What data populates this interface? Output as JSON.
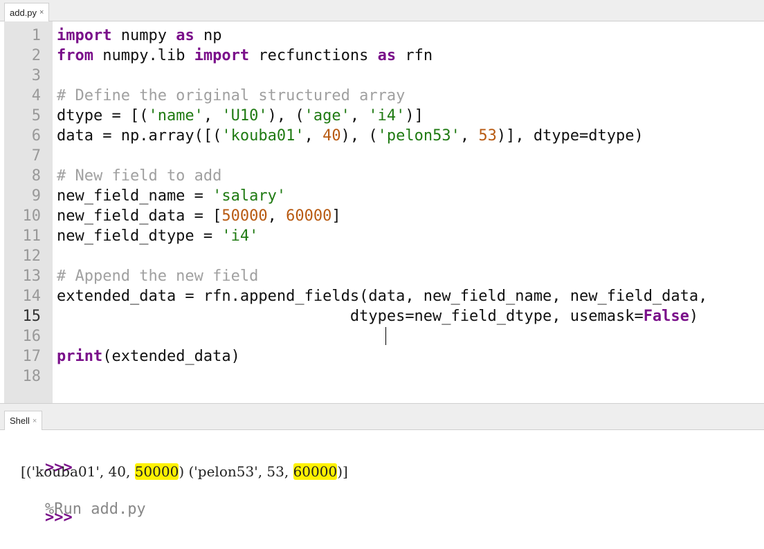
{
  "editor": {
    "tab": {
      "label": "add.py",
      "close": "×"
    },
    "lines": [
      {
        "num": "1",
        "tokens": [
          {
            "t": "kw",
            "v": "import"
          },
          {
            "t": "",
            "v": " numpy "
          },
          {
            "t": "kw",
            "v": "as"
          },
          {
            "t": "",
            "v": " np"
          }
        ]
      },
      {
        "num": "2",
        "tokens": [
          {
            "t": "kw",
            "v": "from"
          },
          {
            "t": "",
            "v": " numpy.lib "
          },
          {
            "t": "kw",
            "v": "import"
          },
          {
            "t": "",
            "v": " recfunctions "
          },
          {
            "t": "kw",
            "v": "as"
          },
          {
            "t": "",
            "v": " rfn"
          }
        ]
      },
      {
        "num": "3",
        "tokens": []
      },
      {
        "num": "4",
        "tokens": [
          {
            "t": "cm",
            "v": "# Define the original structured array"
          }
        ]
      },
      {
        "num": "5",
        "tokens": [
          {
            "t": "",
            "v": "dtype = [("
          },
          {
            "t": "st",
            "v": "'name'"
          },
          {
            "t": "",
            "v": ", "
          },
          {
            "t": "st",
            "v": "'U10'"
          },
          {
            "t": "",
            "v": "), ("
          },
          {
            "t": "st",
            "v": "'age'"
          },
          {
            "t": "",
            "v": ", "
          },
          {
            "t": "st",
            "v": "'i4'"
          },
          {
            "t": "",
            "v": ")]"
          }
        ]
      },
      {
        "num": "6",
        "tokens": [
          {
            "t": "",
            "v": "data = np.array([("
          },
          {
            "t": "st",
            "v": "'kouba01'"
          },
          {
            "t": "",
            "v": ", "
          },
          {
            "t": "nm",
            "v": "40"
          },
          {
            "t": "",
            "v": "), ("
          },
          {
            "t": "st",
            "v": "'pelon53'"
          },
          {
            "t": "",
            "v": ", "
          },
          {
            "t": "nm",
            "v": "53"
          },
          {
            "t": "",
            "v": ")], dtype=dtype)"
          }
        ]
      },
      {
        "num": "7",
        "tokens": []
      },
      {
        "num": "8",
        "tokens": [
          {
            "t": "cm",
            "v": "# New field to add"
          }
        ]
      },
      {
        "num": "9",
        "tokens": [
          {
            "t": "",
            "v": "new_field_name = "
          },
          {
            "t": "st",
            "v": "'salary'"
          }
        ]
      },
      {
        "num": "10",
        "tokens": [
          {
            "t": "",
            "v": "new_field_data = ["
          },
          {
            "t": "nm",
            "v": "50000"
          },
          {
            "t": "",
            "v": ", "
          },
          {
            "t": "nm",
            "v": "60000"
          },
          {
            "t": "",
            "v": "]"
          }
        ]
      },
      {
        "num": "11",
        "tokens": [
          {
            "t": "",
            "v": "new_field_dtype = "
          },
          {
            "t": "st",
            "v": "'i4'"
          }
        ]
      },
      {
        "num": "12",
        "tokens": []
      },
      {
        "num": "13",
        "tokens": [
          {
            "t": "cm",
            "v": "# Append the new field"
          }
        ]
      },
      {
        "num": "14",
        "tokens": [
          {
            "t": "",
            "v": "extended_data = rfn.append_fields(data, new_field_name, new_field_data,"
          }
        ]
      },
      {
        "num": "15",
        "current": true,
        "tokens": [
          {
            "t": "",
            "v": "                                dtypes=new_field_dtype, usemask="
          },
          {
            "t": "kw",
            "v": "False"
          },
          {
            "t": "",
            "v": ")"
          }
        ]
      },
      {
        "num": "16",
        "tokens": []
      },
      {
        "num": "17",
        "tokens": [
          {
            "t": "kw",
            "v": "print"
          },
          {
            "t": "",
            "v": "(extended_data)"
          }
        ]
      },
      {
        "num": "18",
        "tokens": []
      }
    ]
  },
  "shell": {
    "tab": {
      "label": "Shell",
      "close": "×"
    },
    "prompt": ">>>",
    "command": "%Run add.py",
    "output": [
      {
        "t": "",
        "v": "[('kouba01', 40, "
      },
      {
        "t": "hl",
        "v": "50000"
      },
      {
        "t": "",
        "v": ") ('pelon53', 53, "
      },
      {
        "t": "hl",
        "v": "60000"
      },
      {
        "t": "",
        "v": ")]"
      }
    ],
    "highlight_color": "#fff200"
  }
}
